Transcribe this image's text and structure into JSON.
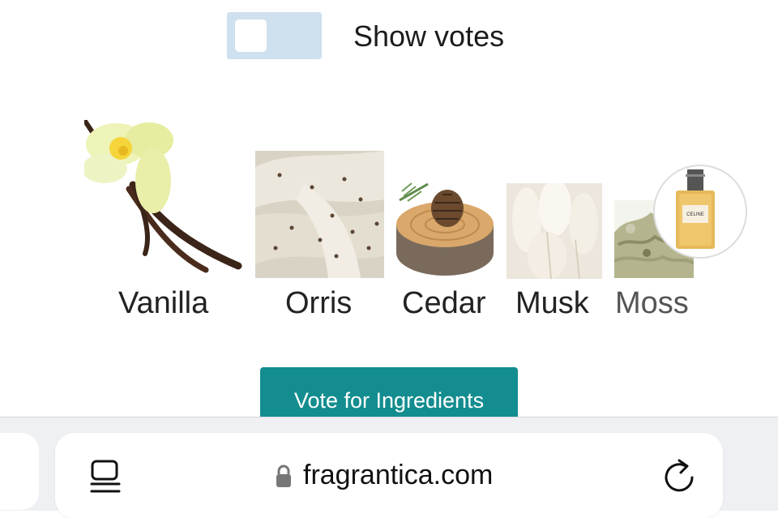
{
  "toggle": {
    "label": "Show votes",
    "checked": false
  },
  "notes": [
    {
      "name": "Vanilla"
    },
    {
      "name": "Orris"
    },
    {
      "name": "Cedar"
    },
    {
      "name": "Musk"
    },
    {
      "name": "Moss"
    }
  ],
  "vote_button": {
    "label": "Vote for Ingredients"
  },
  "browser": {
    "url": "fragrantica.com",
    "icons": {
      "tabs": "tab-overview-icon",
      "lock": "lock-icon",
      "reload": "reload-icon"
    }
  },
  "thumbnail": {
    "brand": "CELINE"
  },
  "colors": {
    "accent": "#138d8f",
    "toggle_bg": "#cfe0ef"
  }
}
